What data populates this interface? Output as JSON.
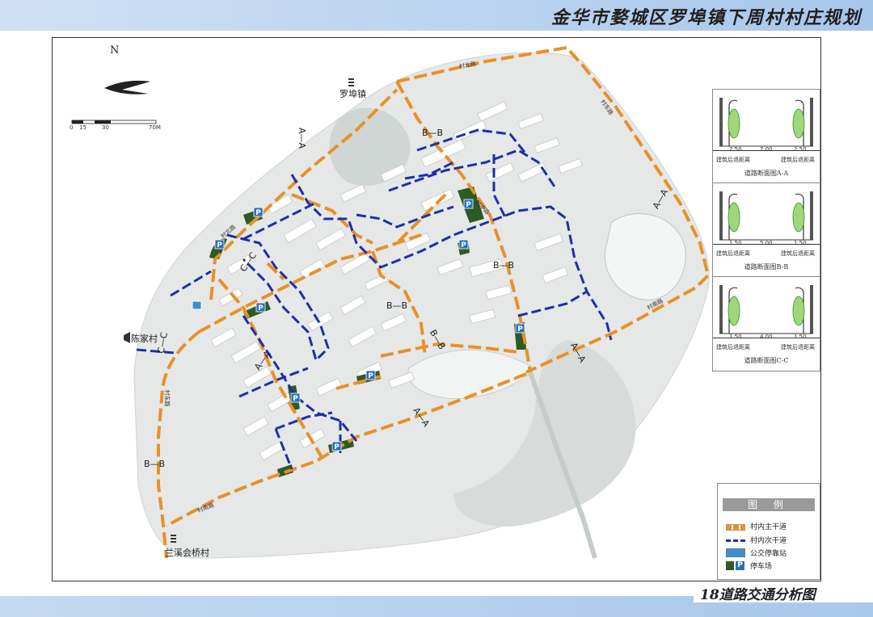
{
  "header": {
    "title": "金华市婺城区罗埠镇下周村村庄规划",
    "band_color": "#b9d2ee"
  },
  "footer": {
    "title": "18道路交通分析图"
  },
  "north": {
    "label": "N"
  },
  "scale_bar": {
    "ticks": [
      "0",
      "15",
      "30",
      "70M"
    ]
  },
  "places": {
    "luobu": "罗埠镇",
    "chenjia": "陈家村",
    "lanxi": "兰溪会桥村"
  },
  "road_names": {
    "north": "村北路",
    "east": "村东路",
    "south_east": "村南路",
    "south": "村南路",
    "west": "村东路",
    "nw": "村北路",
    "inner": "村中路"
  },
  "section_labels": {
    "aa1": "A—A",
    "aa2": "A—A",
    "aa3": "A—A",
    "aa4": "A—A",
    "aa5": "A—A",
    "bb1": "B—B",
    "bb2": "B—B",
    "bb3": "B—B",
    "bb4": "B—B",
    "bb5": "B—B",
    "cc1": "C—C",
    "cc2": "C—C"
  },
  "sections": [
    {
      "caption": "道路断面图A-A",
      "dims": [
        "2.50",
        "7.00",
        "2.50"
      ],
      "left": "建筑后退距离",
      "right": "建筑后退距离"
    },
    {
      "caption": "道路断面图B-B",
      "dims": [
        "1.50",
        "5.00",
        "1.50"
      ],
      "left": "建筑后退距离",
      "right": "建筑后退距离"
    },
    {
      "caption": "道路断面图C-C",
      "dims": [
        "1.50",
        "4.00",
        "1.50"
      ],
      "left": "建筑后退距离",
      "right": "建筑后退距离"
    }
  ],
  "legend": {
    "title": "图 例",
    "items": [
      {
        "label": "村内主干道",
        "symbol": "orange-dashed-line",
        "color": "#e8902a"
      },
      {
        "label": "村内次干道",
        "symbol": "blue-dashed-line",
        "color": "#1f2fa8"
      },
      {
        "label": "公交停靠站",
        "symbol": "bus-stop-icon",
        "color": "#3a8fd0"
      },
      {
        "label": "停车场",
        "symbol": "parking-icon",
        "color": "#2e5a25"
      }
    ]
  },
  "colors": {
    "main_road": "#e8902a",
    "secondary_road": "#1f2fa8",
    "parking": "#2e5a25",
    "parking_sign": "#2a6fc0"
  }
}
